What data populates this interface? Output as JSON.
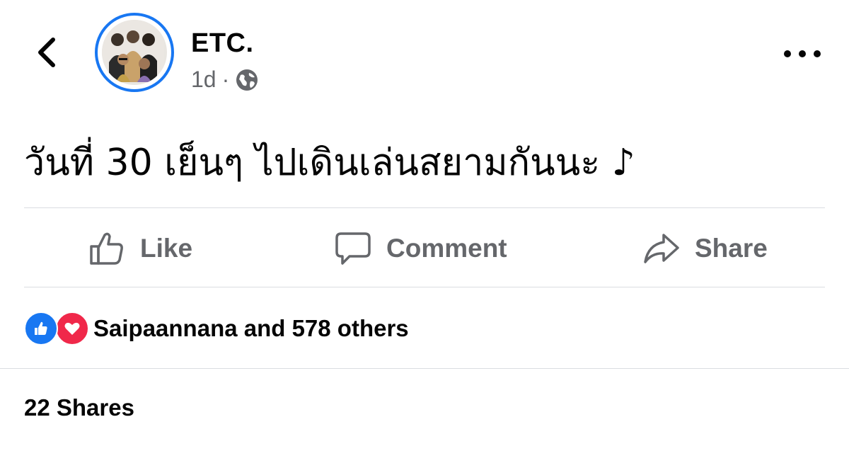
{
  "post": {
    "author": "ETC.",
    "time": "1d",
    "separator": "·",
    "audience_icon": "globe-icon",
    "text": "วันที่ 30 เย็นๆ ไปเดินเล่นสยามกันนะ ♪"
  },
  "actions": {
    "like_label": "Like",
    "comment_label": "Comment",
    "share_label": "Share"
  },
  "reactions": {
    "icons": [
      "like-icon",
      "love-icon"
    ],
    "summary": "Saipaannana and 578 others"
  },
  "shares": {
    "label": "22 Shares"
  },
  "colors": {
    "accent": "#1877f2",
    "love": "#f0284a",
    "secondary_text": "#65676b",
    "divider": "#dadde1"
  }
}
